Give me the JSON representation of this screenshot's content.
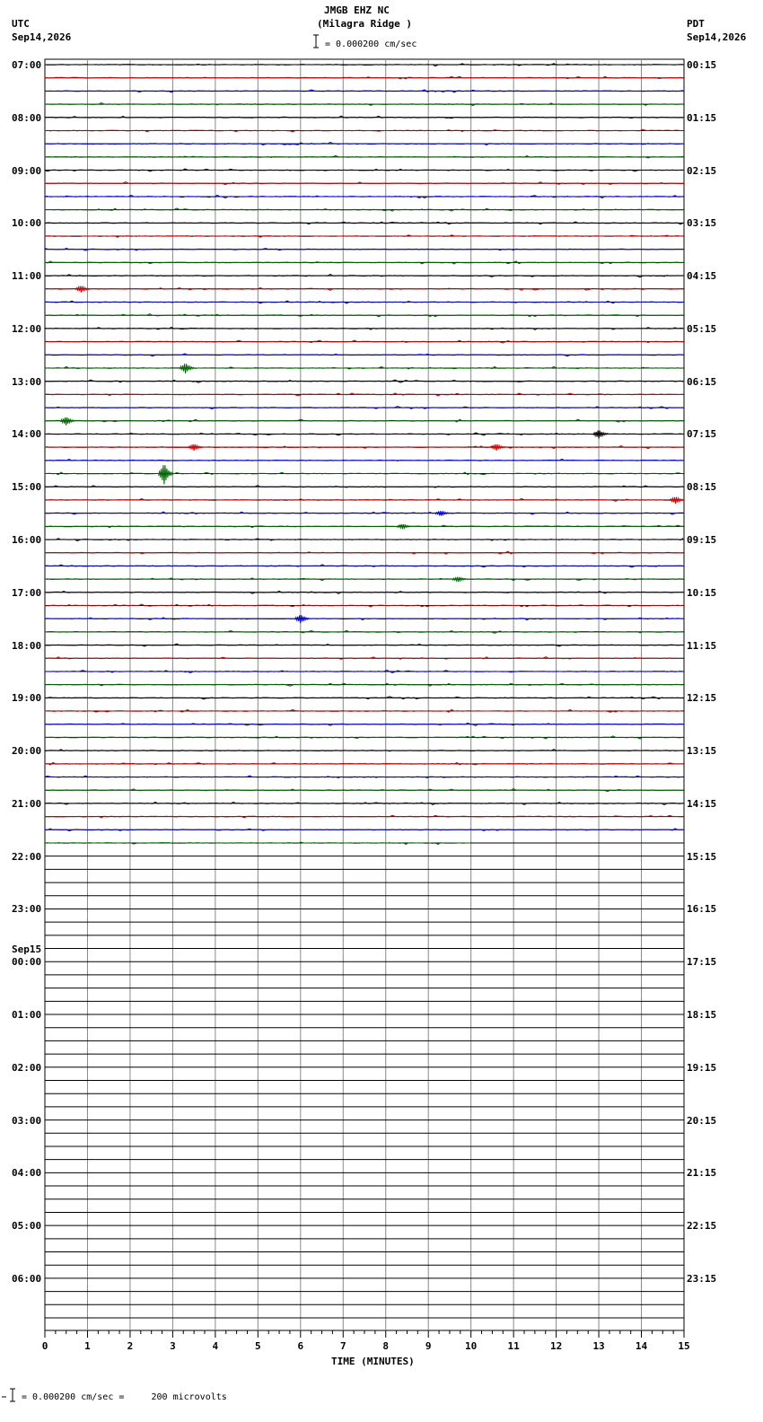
{
  "header": {
    "station": "JMGB EHZ NC",
    "location": "(Milagra Ridge )",
    "scale_text": "= 0.000200 cm/sec",
    "left_tz": "UTC",
    "left_date": "Sep14,2026",
    "right_tz": "PDT",
    "right_date": "Sep14,2026"
  },
  "footer": {
    "scale_note": "= 0.000200 cm/sec =     200 microvolts"
  },
  "chart_data": {
    "type": "line",
    "title": "JMGB EHZ NC (Milagra Ridge )",
    "xlabel": "TIME (MINUTES)",
    "xlim": [
      0,
      15
    ],
    "x_ticks": [
      "0",
      "1",
      "2",
      "3",
      "4",
      "5",
      "6",
      "7",
      "8",
      "9",
      "10",
      "11",
      "12",
      "13",
      "14",
      "15"
    ],
    "rows_per_hour": 4,
    "total_rows": 96,
    "recorded_rows": 60,
    "last_row_end_minute": 10,
    "trace_colors": [
      "#000000",
      "#cc0000",
      "#0000cc",
      "#006600"
    ],
    "utc_labels": [
      "07:00",
      "08:00",
      "09:00",
      "10:00",
      "11:00",
      "12:00",
      "13:00",
      "14:00",
      "15:00",
      "16:00",
      "17:00",
      "18:00",
      "19:00",
      "20:00",
      "21:00",
      "22:00",
      "23:00",
      "00:00",
      "01:00",
      "02:00",
      "03:00",
      "04:00",
      "05:00",
      "06:00"
    ],
    "date_change": {
      "hour_index": 17,
      "label": "Sep15"
    },
    "pdt_labels": [
      "00:15",
      "01:15",
      "02:15",
      "03:15",
      "04:15",
      "05:15",
      "06:15",
      "07:15",
      "08:15",
      "09:15",
      "10:15",
      "11:15",
      "12:15",
      "13:15",
      "14:15",
      "15:15",
      "16:15",
      "17:15",
      "18:15",
      "19:15",
      "20:15",
      "21:15",
      "22:15",
      "23:15"
    ],
    "events": [
      {
        "row": 17,
        "minute": 0.85,
        "amplitude": 4,
        "color": "#cc0000"
      },
      {
        "row": 23,
        "minute": 3.3,
        "amplitude": 6,
        "color": "#006600"
      },
      {
        "row": 27,
        "minute": 0.5,
        "amplitude": 5,
        "color": "#006600"
      },
      {
        "row": 28,
        "minute": 13.0,
        "amplitude": 5,
        "color": "#000000"
      },
      {
        "row": 29,
        "minute": 3.5,
        "amplitude": 4,
        "color": "#cc0000"
      },
      {
        "row": 29,
        "minute": 10.6,
        "amplitude": 4,
        "color": "#cc0000"
      },
      {
        "row": 31,
        "minute": 2.8,
        "amplitude": 12,
        "color": "#006600"
      },
      {
        "row": 33,
        "minute": 14.8,
        "amplitude": 4,
        "color": "#cc0000"
      },
      {
        "row": 34,
        "minute": 9.3,
        "amplitude": 3,
        "color": "#0000cc"
      },
      {
        "row": 35,
        "minute": 8.4,
        "amplitude": 3,
        "color": "#006600"
      },
      {
        "row": 39,
        "minute": 9.7,
        "amplitude": 3,
        "color": "#006600"
      },
      {
        "row": 42,
        "minute": 6.0,
        "amplitude": 5,
        "color": "#0000cc"
      }
    ]
  }
}
